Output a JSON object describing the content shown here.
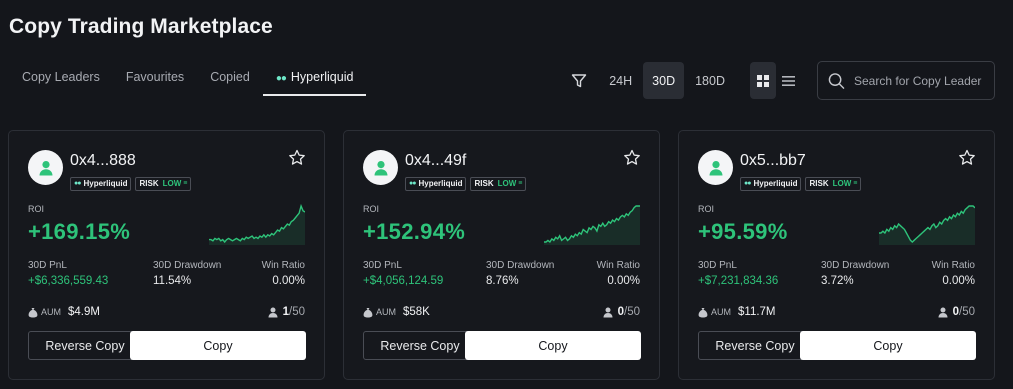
{
  "page_title": "Copy Trading Marketplace",
  "tabs": [
    {
      "label": "Copy Leaders",
      "active": false
    },
    {
      "label": "Favourites",
      "active": false
    },
    {
      "label": "Copied",
      "active": false
    },
    {
      "label": "Hyperliquid",
      "active": true,
      "icon": "hyperliquid-icon"
    }
  ],
  "toolbar": {
    "periods": [
      {
        "label": "24H",
        "active": false
      },
      {
        "label": "30D",
        "active": true
      },
      {
        "label": "180D",
        "active": false
      }
    ],
    "view_modes": [
      "grid-view-icon",
      "list-view-icon"
    ],
    "active_view": "grid",
    "search_placeholder": "Search for Copy Leader"
  },
  "card_labels": {
    "exchange_badge": "Hyperliquid",
    "risk_label": "RISK",
    "roi": "ROI",
    "pnl": "30D PnL",
    "drawdown": "30D Drawdown",
    "win_ratio": "Win Ratio",
    "aum": "AUM",
    "reverse_copy": "Reverse Copy",
    "copy": "Copy"
  },
  "traders": [
    {
      "name": "0x4...888",
      "risk": "LOW",
      "roi": "+169.15%",
      "pnl": "+$6,336,559.43",
      "drawdown": "11.54%",
      "win_ratio": "0.00%",
      "aum": "$4.9M",
      "copiers_current": "1",
      "copiers_max": "/50",
      "sparkline": [
        30,
        30,
        29,
        31,
        30,
        31,
        29,
        30,
        28,
        30,
        31,
        30,
        29,
        30,
        31,
        30,
        29,
        31,
        30,
        32,
        31,
        32,
        33,
        31,
        32,
        31,
        33,
        32,
        34,
        32,
        34,
        33,
        35,
        34,
        36,
        38,
        37,
        40,
        39,
        41,
        43,
        42,
        45,
        46,
        48,
        50,
        52,
        58,
        54,
        53
      ]
    },
    {
      "name": "0x4...49f",
      "risk": "LOW",
      "roi": "+152.94%",
      "pnl": "+$4,056,124.59",
      "drawdown": "8.76%",
      "win_ratio": "0.00%",
      "aum": "$58K",
      "copiers_current": "0",
      "copiers_max": "/50",
      "sparkline": [
        30,
        30,
        31,
        30,
        32,
        31,
        33,
        32,
        34,
        31,
        32,
        33,
        31,
        32,
        34,
        33,
        35,
        34,
        36,
        35,
        38,
        37,
        36,
        39,
        38,
        40,
        39,
        37,
        41,
        40,
        42,
        40,
        41,
        43,
        42,
        44,
        43,
        45,
        44,
        46,
        47,
        46,
        48,
        47,
        49,
        50,
        52,
        53,
        53,
        53
      ]
    },
    {
      "name": "0x5...bb7",
      "risk": "LOW",
      "roi": "+95.59%",
      "pnl": "+$7,231,834.36",
      "drawdown": "3.72%",
      "win_ratio": "0.00%",
      "aum": "$11.7M",
      "copiers_current": "0",
      "copiers_max": "/50",
      "sparkline": [
        40,
        40,
        41,
        40,
        42,
        41,
        43,
        42,
        44,
        43,
        45,
        44,
        43,
        42,
        40,
        38,
        36,
        35,
        36,
        37,
        38,
        39,
        40,
        41,
        42,
        43,
        42,
        44,
        45,
        43,
        44,
        46,
        45,
        47,
        48,
        47,
        49,
        48,
        50,
        49,
        51,
        50,
        52,
        51,
        53,
        54,
        55,
        55,
        55,
        54
      ]
    }
  ]
}
